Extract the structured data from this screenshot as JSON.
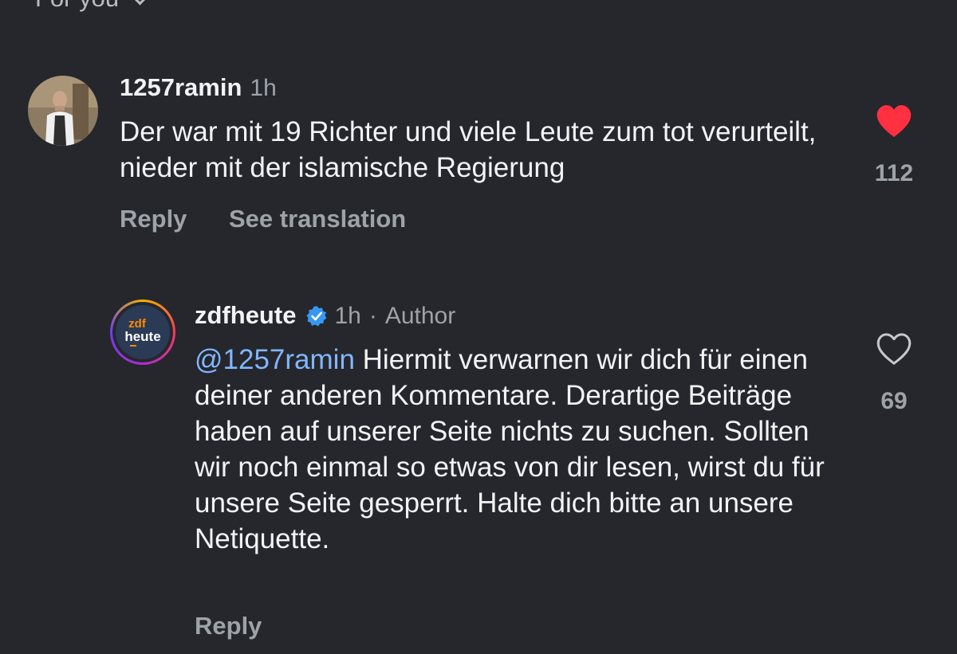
{
  "header": {
    "filter_label": "For you"
  },
  "comments": [
    {
      "username": "1257ramin",
      "time": "1h",
      "text": "Der war mit 19 Richter und viele Leute zum tot verurteilt, nieder mit der islamische Regierung",
      "reply_label": "Reply",
      "translate_label": "See translation",
      "like_count": "112",
      "liked": true,
      "colors": {
        "like": "#ff3040"
      }
    }
  ],
  "reply": {
    "username": "zdfheute",
    "verified": true,
    "time": "1h",
    "separator": "·",
    "author_badge": "Author",
    "mention": "@1257ramin",
    "text": "Hiermit verwarnen wir dich für einen deiner anderen Kommentare. Derartige Beiträge haben auf unserer Seite nichts zu suchen. Sollten wir noch einmal so etwas von dir lesen, wirst du für unsere Seite gesperrt. Halte dich bitte an unsere Netiquette.",
    "reply_label": "Reply",
    "like_count": "69",
    "liked": false,
    "avatar_logo": {
      "line1": "zdf",
      "line2": "heute"
    },
    "colors": {
      "verified": "#3897f0",
      "mention": "#82b6ff"
    }
  }
}
